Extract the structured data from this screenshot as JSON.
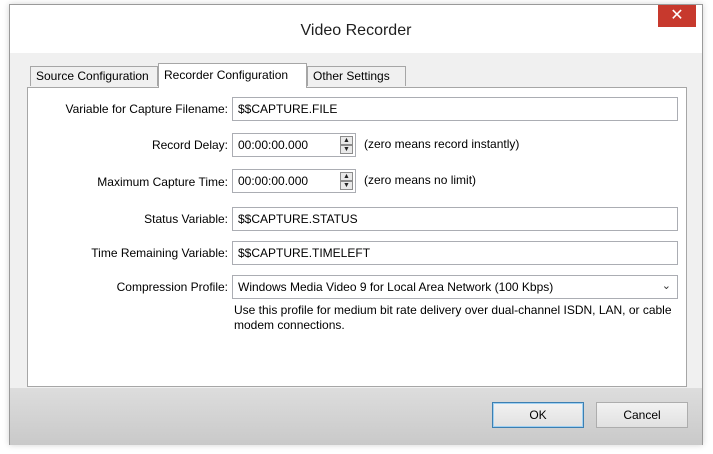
{
  "window": {
    "title": "Video Recorder"
  },
  "tabs": [
    {
      "label": "Source Configuration"
    },
    {
      "label": "Recorder Configuration"
    },
    {
      "label": "Other Settings"
    }
  ],
  "active_tab": "Recorder Configuration",
  "form": {
    "capture_filename": {
      "label": "Variable for Capture Filename:",
      "value": "$$CAPTURE.FILE"
    },
    "record_delay": {
      "label": "Record Delay:",
      "value": "00:00:00.000",
      "note": "(zero means record instantly)"
    },
    "max_capture_time": {
      "label": "Maximum Capture Time:",
      "value": "00:00:00.000",
      "note": "(zero means no limit)"
    },
    "status_variable": {
      "label": "Status Variable:",
      "value": "$$CAPTURE.STATUS"
    },
    "time_remaining": {
      "label": "Time Remaining Variable:",
      "value": "$$CAPTURE.TIMELEFT"
    },
    "compression_profile": {
      "label": "Compression Profile:",
      "value": "Windows Media Video 9 for Local Area Network (100 Kbps)",
      "description": "Use this profile for medium bit rate delivery over dual-channel ISDN, LAN, or cable modem connections."
    }
  },
  "buttons": {
    "ok": "OK",
    "cancel": "Cancel",
    "close": "✕"
  },
  "colors": {
    "close_button": "#c7392d",
    "footer": "#d4d4d4",
    "default_button_border": "#3c7fb1"
  },
  "icons": {
    "close": "close-icon",
    "spin_up": "up-arrow-icon",
    "spin_down": "down-arrow-icon",
    "dropdown": "chevron-down-icon"
  }
}
